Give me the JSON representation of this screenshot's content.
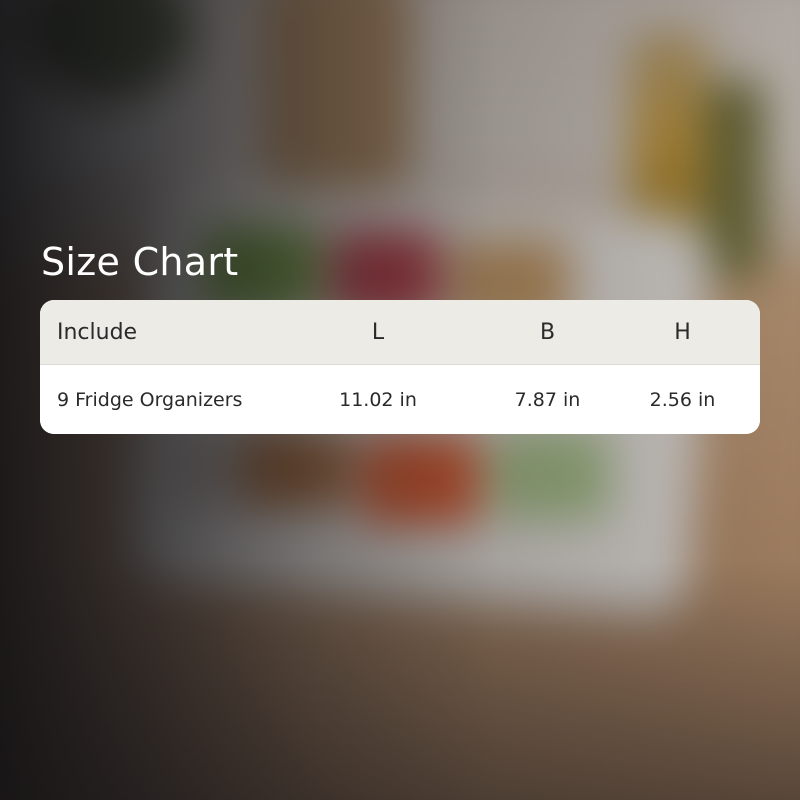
{
  "title": "Size Chart",
  "table": {
    "headers": [
      "Include",
      "L",
      "B",
      "H"
    ],
    "rows": [
      [
        "9 Fridge Organizers",
        "11.02 in",
        "7.87 in",
        "2.56 in"
      ]
    ]
  },
  "colors": {
    "header_bg": "#ecebe6",
    "row_bg": "#ffffff",
    "title_text": "#ffffff",
    "cell_text": "#2a2a2a"
  }
}
